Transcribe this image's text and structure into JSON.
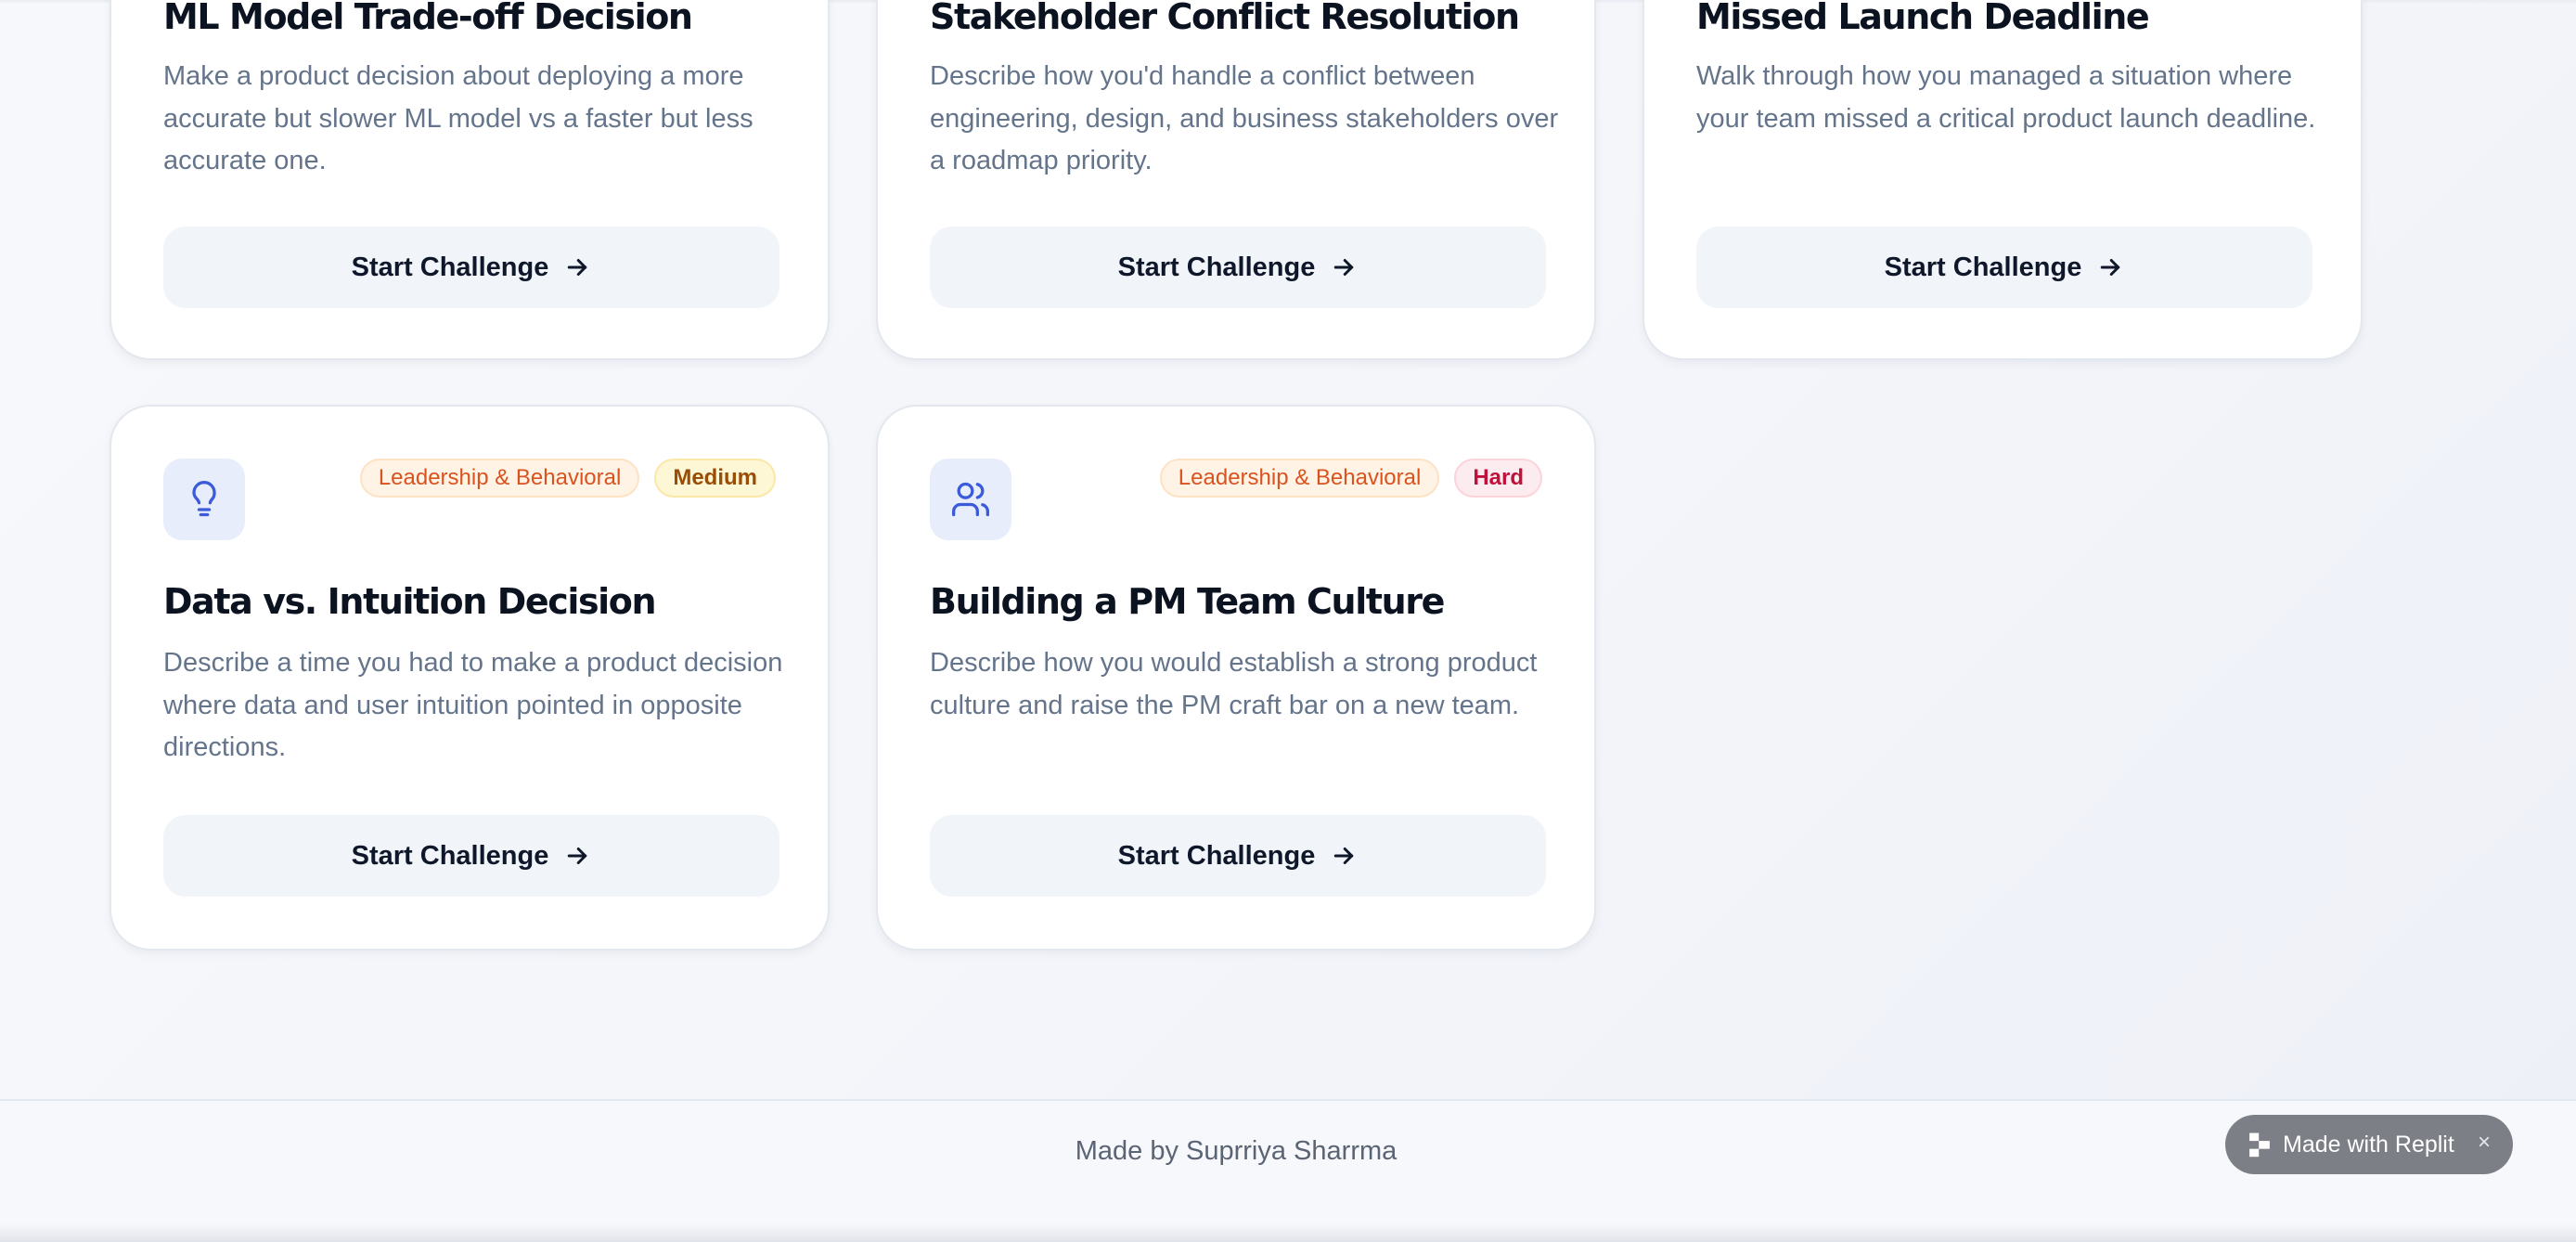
{
  "cards_top_row": [
    {
      "title": "ML Model Trade-off Decision",
      "description": "Make a product decision about deploying a more accurate but slower ML model vs a faster but less accurate one.",
      "button_label": "Start Challenge"
    },
    {
      "title": "Stakeholder Conflict Resolution",
      "description": "Describe how you'd handle a conflict between engineering, design, and business stakeholders over a roadmap priority.",
      "button_label": "Start Challenge"
    },
    {
      "title": "Missed Launch Deadline",
      "description": "Walk through how you managed a situation where your team missed a critical product launch deadline.",
      "button_label": "Start Challenge"
    }
  ],
  "cards_bottom_row": [
    {
      "icon": "lightbulb-icon",
      "category": "Leadership & Behavioral",
      "difficulty": "Medium",
      "title": "Data vs. Intuition Decision",
      "description": "Describe a time you had to make a product decision where data and user intuition pointed in opposite directions.",
      "button_label": "Start Challenge"
    },
    {
      "icon": "users-icon",
      "category": "Leadership & Behavioral",
      "difficulty": "Hard",
      "title": "Building a PM Team Culture",
      "description": "Describe how you would establish a strong product culture and raise the PM craft bar on a new team.",
      "button_label": "Start Challenge"
    }
  ],
  "footer": {
    "credit": "Made by Suprriya Sharrma"
  },
  "replit_badge": {
    "label": "Made with Replit",
    "close": "×"
  },
  "colors": {
    "accent_icon": "#3b5bdb",
    "icon_bg": "#e8edfb",
    "category_badge": "#d9531e",
    "medium_badge": "#9a4d06",
    "hard_badge": "#be123c"
  }
}
